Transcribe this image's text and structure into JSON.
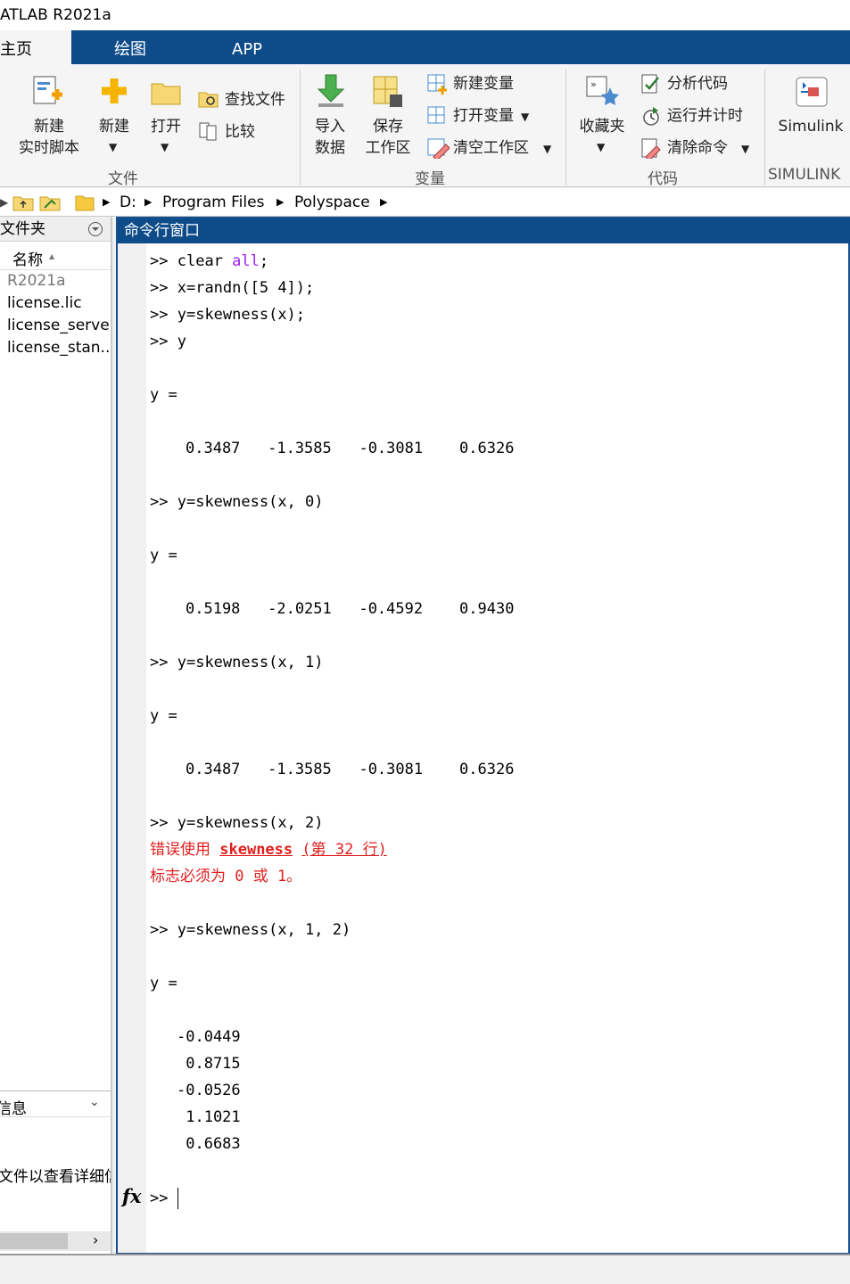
{
  "window": {
    "title": "ATLAB R2021a"
  },
  "tabs": [
    {
      "label": "主页",
      "active": true
    },
    {
      "label": "绘图",
      "active": false
    },
    {
      "label": "APP",
      "active": false
    }
  ],
  "ribbon": {
    "file": {
      "new_live_script": {
        "line1": "新建",
        "line2": "实时脚本"
      },
      "new": "新建",
      "open": "打开",
      "find_files": "查找文件",
      "compare": "比较",
      "group_label": "文件"
    },
    "variable": {
      "import": {
        "line1": "导入",
        "line2": "数据"
      },
      "save": {
        "line1": "保存",
        "line2": "工作区"
      },
      "new_variable": "新建变量",
      "open_variable": "打开变量",
      "clear_workspace": "清空工作区",
      "group_label": "变量"
    },
    "code": {
      "favorites": "收藏夹",
      "analyze": "分析代码",
      "run_time": "运行并计时",
      "clear_commands": "清除命令",
      "group_label": "代码"
    },
    "simulink": {
      "button": "Simulink",
      "group_label": "SIMULINK"
    }
  },
  "address": {
    "crumbs": [
      "D:",
      "Program Files",
      "Polyspace"
    ]
  },
  "sidebar": {
    "title": "文件夹",
    "column": "名称",
    "sort_indicator": "▲",
    "files": [
      "R2021a",
      "license.lic",
      "license_serve...",
      "license_stan..."
    ],
    "details_title": "信息",
    "details_text": "文件以查看详细信"
  },
  "command_window": {
    "title": "命令行窗口",
    "prompt": ">>",
    "fx": "fx",
    "cmd_clear": "clear",
    "cmd_clear_arg": "all",
    "cmd2": "x=randn([5 4]);",
    "cmd3": "y=skewness(x);",
    "cmd4": "y",
    "y_label": "y =",
    "row1": "0.3487   -1.3585   -0.3081    0.6326",
    "cmd5": "y=skewness(x, 0)",
    "row2": "0.5198   -2.0251   -0.4592    0.9430",
    "cmd6": "y=skewness(x, 1)",
    "row3": "0.3487   -1.3585   -0.3081    0.6326",
    "cmd7": "y=skewness(x, 2)",
    "err_prefix": "错误使用",
    "err_func": "skewness",
    "err_suffix": "(第 32 行)",
    "err_msg": "标志必须为 0 或 1。",
    "cmd8": "y=skewness(x, 1, 2)",
    "col_vals": [
      "-0.0449",
      " 0.8715",
      "-0.0526",
      " 1.1021",
      " 0.6683"
    ]
  },
  "colors": {
    "accent": "#0e4c89",
    "error": "#e0201f",
    "keyword": "#a020f0"
  }
}
